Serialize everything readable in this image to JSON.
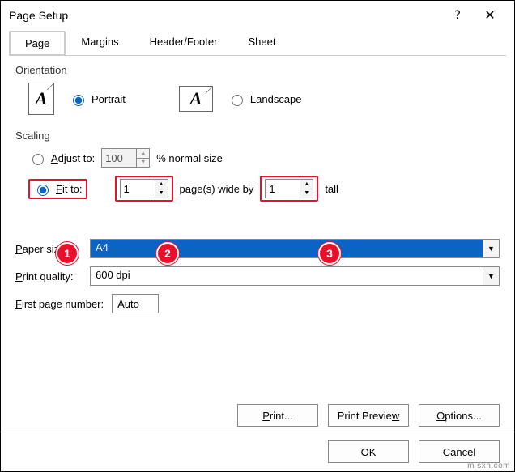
{
  "window": {
    "title": "Page Setup",
    "help": "?",
    "close": "✕"
  },
  "tabs": {
    "page": "Page",
    "margins": "Margins",
    "header_footer": "Header/Footer",
    "sheet": "Sheet"
  },
  "orientation": {
    "label": "Orientation",
    "portrait": "Portrait",
    "landscape": "Landscape",
    "selected": "portrait"
  },
  "scaling": {
    "label": "Scaling",
    "adjust_to": "Adjust to:",
    "adjust_value": "100",
    "normal_size": "% normal size",
    "fit_to": "Fit to:",
    "fit_wide": "1",
    "pages_wide_by": "page(s) wide by",
    "fit_tall": "1",
    "tall": "tall",
    "selected": "fit"
  },
  "paper": {
    "size_label": "Paper size:",
    "size_value": "A4",
    "quality_label": "Print quality:",
    "quality_value": "600 dpi"
  },
  "first_page": {
    "label": "First page number:",
    "value": "Auto"
  },
  "buttons": {
    "print": "Print...",
    "preview": "Print Preview",
    "options": "Options...",
    "ok": "OK",
    "cancel": "Cancel"
  },
  "callouts": {
    "c1": "1",
    "c2": "2",
    "c3": "3"
  },
  "watermark": "m sxn.com"
}
